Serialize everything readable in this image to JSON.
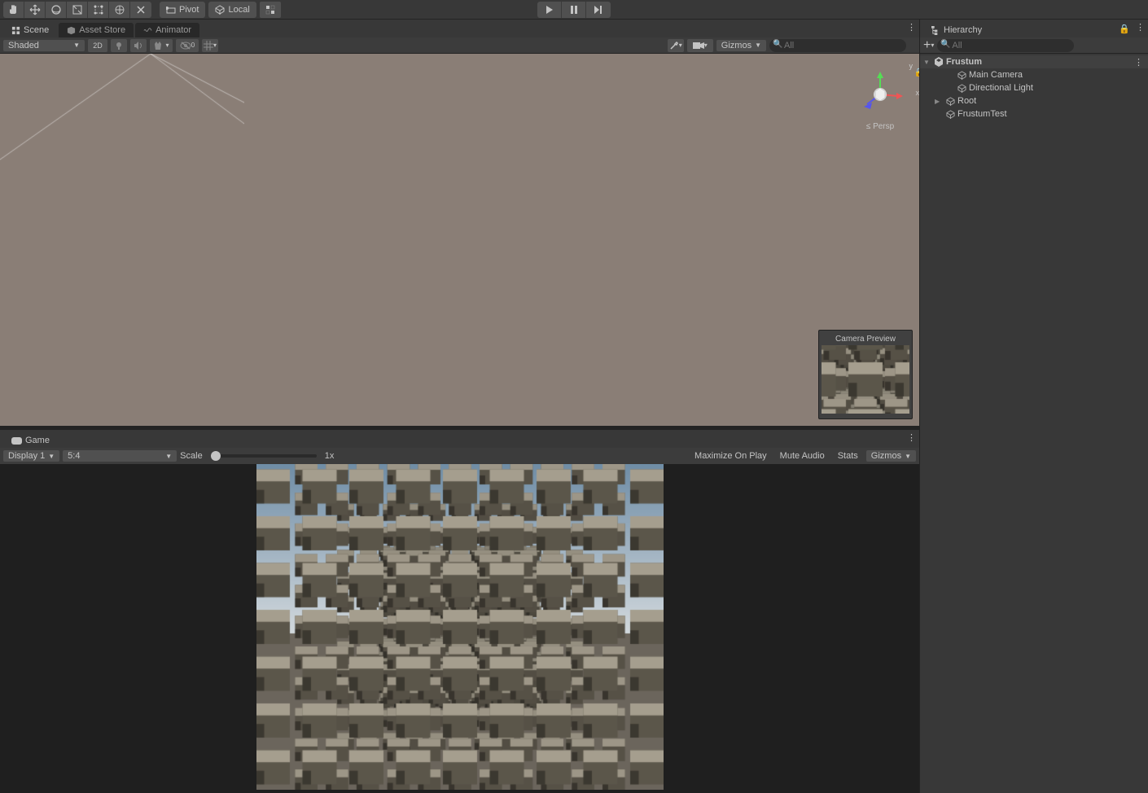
{
  "toolbar": {
    "pivot_label": "Pivot",
    "local_label": "Local"
  },
  "tabs": {
    "scene": "Scene",
    "assetstore": "Asset Store",
    "animator": "Animator",
    "game": "Game"
  },
  "scene_bar": {
    "shading": "Shaded",
    "mode2d": "2D",
    "gizmos": "Gizmos",
    "search_placeholder": "All"
  },
  "scene": {
    "axis_y": "y",
    "axis_x": "x",
    "proj": "Persp",
    "proj_arrow": "≤",
    "camera_preview_label": "Camera Preview"
  },
  "game_bar": {
    "display": "Display 1",
    "aspect": "5:4",
    "scale_label": "Scale",
    "scale_value": "1x",
    "maximize": "Maximize On Play",
    "mute": "Mute Audio",
    "stats": "Stats",
    "gizmos": "Gizmos"
  },
  "hierarchy": {
    "title": "Hierarchy",
    "search_placeholder": "All",
    "scene_name": "Frustum",
    "items": [
      {
        "label": "Main Camera",
        "indent": 2,
        "icon": "obj"
      },
      {
        "label": "Directional Light",
        "indent": 2,
        "icon": "obj"
      },
      {
        "label": "Root",
        "indent": 1,
        "icon": "obj",
        "expand": true
      },
      {
        "label": "FrustumTest",
        "indent": 1,
        "icon": "obj"
      }
    ]
  }
}
